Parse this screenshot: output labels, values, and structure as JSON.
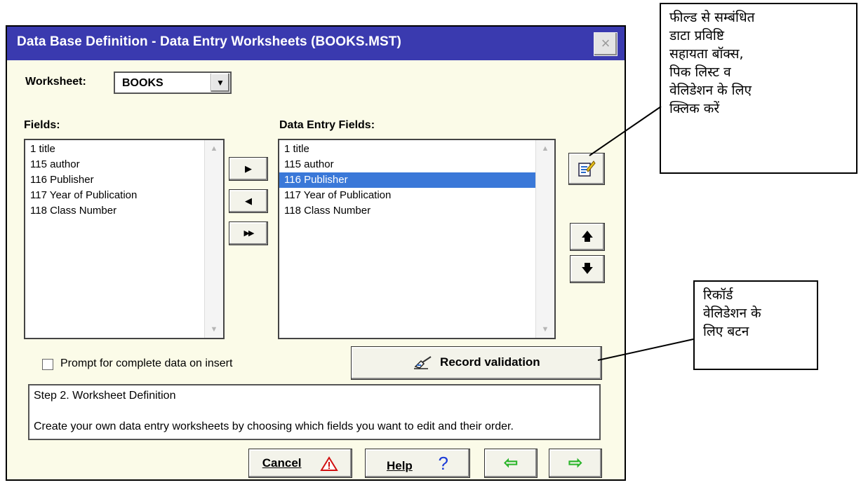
{
  "dialog": {
    "title": "Data Base Definition - Data Entry Worksheets (BOOKS.MST)",
    "close_symbol": "×",
    "worksheet_label": "Worksheet:",
    "worksheet_value": "BOOKS",
    "fields_label": "Fields:",
    "data_entry_fields_label": "Data Entry Fields:",
    "fields": [
      "1 title",
      "115 author",
      "116 Publisher",
      "117 Year of Publication",
      "118 Class Number"
    ],
    "data_entry_fields": [
      "1 title",
      "115 author",
      "116 Publisher",
      "117 Year of Publication",
      "118 Class Number"
    ],
    "selected_entry_index": 2,
    "move_right_symbol": "▶",
    "move_left_symbol": "◀",
    "move_all_symbol": "▶▶",
    "move_up_symbol": "🡅",
    "move_down_symbol": "🡇",
    "checkbox_label": "Prompt for complete data on insert",
    "checkbox_checked": false,
    "record_validation_label": "Record validation",
    "step_title": "Step 2. Worksheet Definition",
    "step_text": "Create your own data entry worksheets by choosing which fields you want to edit and their order.",
    "cancel_label": "Cancel",
    "help_label": "Help",
    "back_symbol": "⇦",
    "next_symbol": "⇨"
  },
  "callouts": {
    "field_help": [
      "फील्ड से सम्बंधित",
      "डाटा प्रविष्टि",
      "सहायता बॉक्स,",
      "पिक लिस्ट व",
      "वेलिडेशन के लिए",
      "क्लिक करें"
    ],
    "record_validation": [
      "रिकॉर्ड",
      "वेलिडेशन के",
      "लिए बटन"
    ]
  },
  "colors": {
    "titlebar": "#3a3aaf",
    "dialog_bg": "#fbfbe8",
    "selection": "#3a78d8",
    "arrow_green": "#2bb52b",
    "warning_red": "#d01010"
  }
}
